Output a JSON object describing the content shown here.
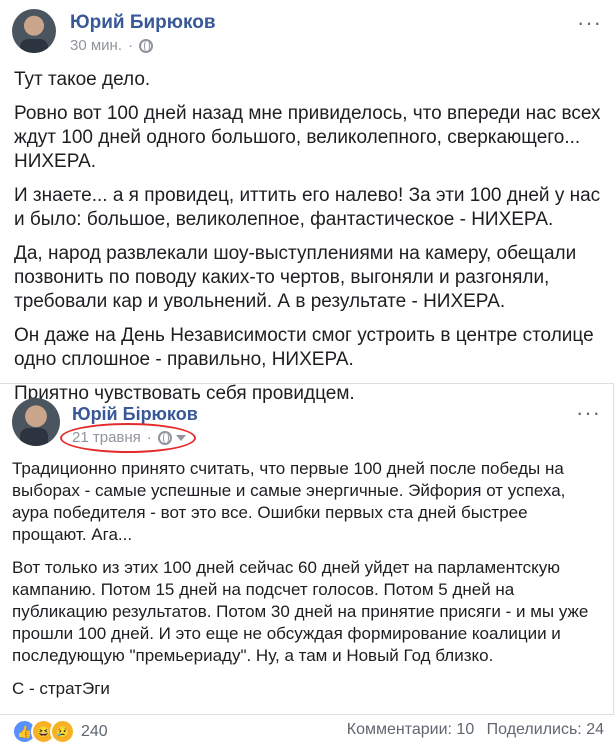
{
  "post": {
    "author": "Юрий Бирюков",
    "time": "30 мин.",
    "paragraphs": [
      "Тут такое дело.",
      "Ровно вот 100 дней назад мне привиделось, что впереди нас всех ждут 100 дней одного большого, великолепного, сверкающего... НИХЕРА.",
      "И знаете... а я провидец, иттить его налево! За эти 100 дней у нас и было: большое, великолепное, фантастическое - НИХЕРА.",
      "Да, народ развлекали шоу-выступлениями на камеру, обещали позвонить по поводу каких-то чертов, выгоняли и разгоняли, требовали кар и увольнений. А в результате - НИХЕРА.",
      "Он даже на День Независимости смог устроить в центре столице одно сплошное - правильно, НИХЕРА.",
      "Приятно чувствовать себя провидцем."
    ]
  },
  "shared": {
    "author": "Юрій Бірюков",
    "date": "21 травня",
    "paragraphs": [
      "Традиционно принято считать, что первые 100 дней после победы на выборах - самые успешные и самые энергичные. Эйфория от успеха, аура победителя - вот это все. Ошибки первых ста дней быстрее прощают. Ага...",
      "Вот только из этих 100 дней сейчас 60 дней уйдет на парламентскую кампанию. Потом 15 дней на подсчет голосов. Потом 5 дней на публикацию результатов. Потом 30 дней на принятие присяги - и мы уже прошли 100 дней. И это еще не обсуждая формирование коалиции и последующую \"премьериаду\". Ну, а там и Новый Год близко.",
      "С - стратЭги"
    ]
  },
  "footer": {
    "reaction_count": "240",
    "comments": "Комментарии: 10",
    "shares": "Поделились: 24"
  },
  "icons": {
    "reactions": [
      "like-icon",
      "haha-icon",
      "sad-icon"
    ],
    "privacy": "globe-icon"
  },
  "colors": {
    "author_link": "#385898",
    "highlight_circle": "#e52a2a",
    "like_blue": "#5890ff"
  }
}
